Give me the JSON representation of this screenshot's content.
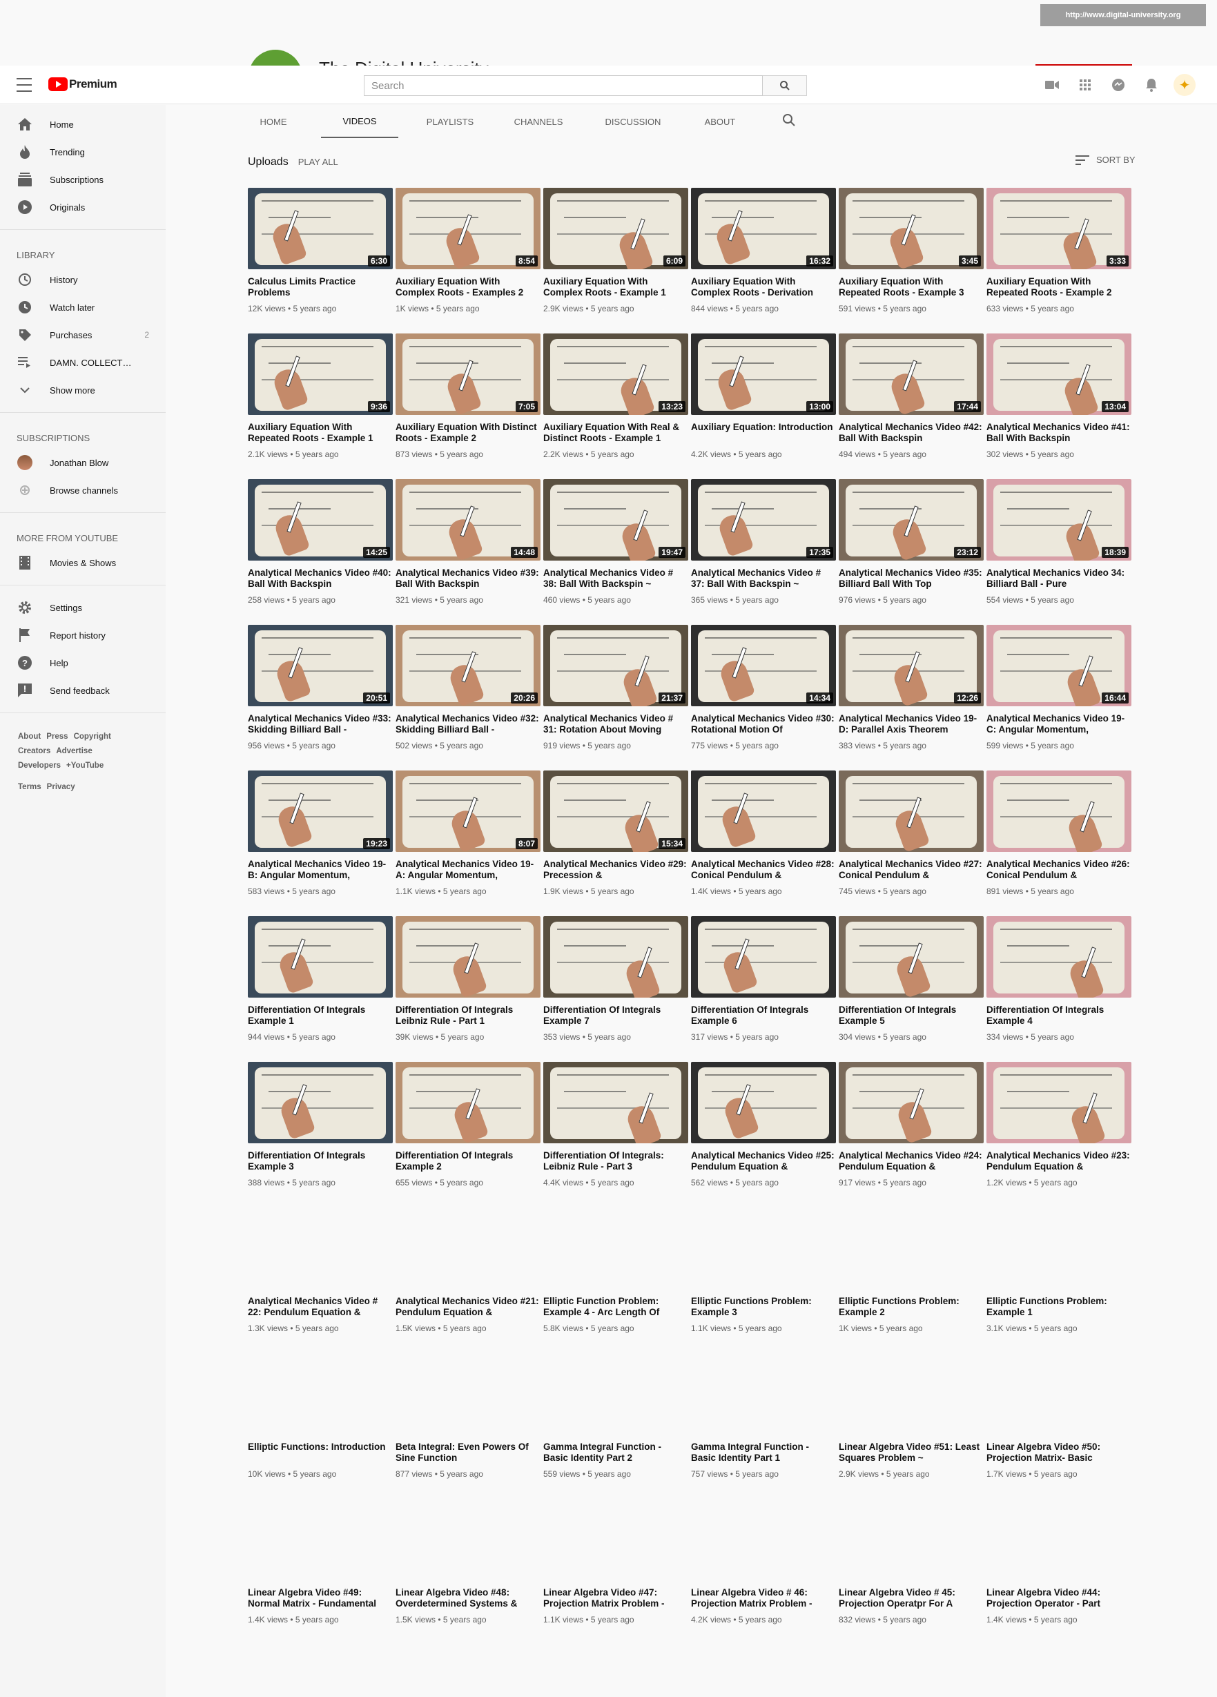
{
  "banner": {
    "url": "http://www.digital-university.org",
    "channel_name_peek": "The Digital University"
  },
  "masthead": {
    "logo_text": "Premium",
    "search_placeholder": "Search"
  },
  "sidebar": {
    "main": [
      {
        "label": "Home",
        "icon": "home-icon"
      },
      {
        "label": "Trending",
        "icon": "fire-icon"
      },
      {
        "label": "Subscriptions",
        "icon": "subscriptions-icon"
      },
      {
        "label": "Originals",
        "icon": "originals-icon"
      }
    ],
    "library_heading": "LIBRARY",
    "library": [
      {
        "label": "History",
        "icon": "history-icon",
        "count": ""
      },
      {
        "label": "Watch later",
        "icon": "clock-icon",
        "count": ""
      },
      {
        "label": "Purchases",
        "icon": "tag-icon",
        "count": "2"
      },
      {
        "label": "DAMN. COLLECT…",
        "icon": "playlist-icon",
        "count": ""
      },
      {
        "label": "Show more",
        "icon": "chevron-down-icon",
        "count": ""
      }
    ],
    "subscriptions_heading": "SUBSCRIPTIONS",
    "subscriptions": [
      {
        "label": "Jonathan Blow"
      },
      {
        "label": "Browse channels"
      }
    ],
    "more_heading": "MORE FROM YOUTUBE",
    "more": [
      {
        "label": "Movies & Shows"
      }
    ],
    "settings": [
      {
        "label": "Settings",
        "icon": "gear-icon"
      },
      {
        "label": "Report history",
        "icon": "flag-icon"
      },
      {
        "label": "Help",
        "icon": "help-icon"
      },
      {
        "label": "Send feedback",
        "icon": "feedback-icon"
      }
    ],
    "footer_line1": [
      "About",
      "Press",
      "Copyright"
    ],
    "footer_line2": [
      "Creators",
      "Advertise"
    ],
    "footer_line3": [
      "Developers",
      "+YouTube"
    ],
    "footer_line4": [
      "Terms",
      "Privacy"
    ]
  },
  "tabs": [
    "HOME",
    "VIDEOS",
    "PLAYLISTS",
    "CHANNELS",
    "DISCUSSION",
    "ABOUT"
  ],
  "active_tab": "VIDEOS",
  "uploads": {
    "title": "Uploads",
    "play_all": "PLAY ALL",
    "sort_by": "SORT BY"
  },
  "videos": [
    {
      "title": "Calculus Limits Practice Problems",
      "meta": "12K views • 5 years ago",
      "duration": "6:30"
    },
    {
      "title": "Auxiliary Equation With Complex Roots - Examples 2",
      "meta": "1K views • 5 years ago",
      "duration": "8:54"
    },
    {
      "title": "Auxiliary Equation With Complex Roots - Example 1",
      "meta": "2.9K views • 5 years ago",
      "duration": "6:09"
    },
    {
      "title": "Auxiliary Equation With Complex Roots - Derivation",
      "meta": "844 views • 5 years ago",
      "duration": "16:32"
    },
    {
      "title": "Auxiliary Equation With Repeated Roots - Example 3",
      "meta": "591 views • 5 years ago",
      "duration": "3:45"
    },
    {
      "title": "Auxiliary Equation With Repeated Roots - Example 2",
      "meta": "633 views • 5 years ago",
      "duration": "3:33"
    },
    {
      "title": "Auxiliary Equation With Repeated Roots - Example 1",
      "meta": "2.1K views • 5 years ago",
      "duration": "9:36"
    },
    {
      "title": "Auxiliary Equation With Distinct Roots - Example 2",
      "meta": "873 views • 5 years ago",
      "duration": "7:05"
    },
    {
      "title": "Auxiliary Equation With Real & Distinct Roots - Example 1",
      "meta": "2.2K views • 5 years ago",
      "duration": "13:23"
    },
    {
      "title": "Auxiliary Equation: Introduction",
      "meta": "4.2K views • 5 years ago",
      "duration": "13:00"
    },
    {
      "title": "Analytical Mechanics Video #42: Ball With Backspin",
      "meta": "494 views • 5 years ago",
      "duration": "17:44"
    },
    {
      "title": "Analytical Mechanics Video #41: Ball With Backspin",
      "meta": "302 views • 5 years ago",
      "duration": "13:04"
    },
    {
      "title": "Analytical Mechanics Video #40: Ball With Backspin",
      "meta": "258 views • 5 years ago",
      "duration": "14:25"
    },
    {
      "title": "Analytical Mechanics Video #39: Ball With Backspin",
      "meta": "321 views • 5 years ago",
      "duration": "14:48"
    },
    {
      "title": "Analytical Mechanics Video # 38: Ball With Backspin ~",
      "meta": "460 views • 5 years ago",
      "duration": "19:47"
    },
    {
      "title": "Analytical Mechanics Video # 37: Ball With Backspin ~",
      "meta": "365 views • 5 years ago",
      "duration": "17:35"
    },
    {
      "title": "Analytical Mechanics Video #35: Billiard Ball With Top",
      "meta": "976 views • 5 years ago",
      "duration": "23:12"
    },
    {
      "title": "Analytical Mechanics Video 34: Billiard Ball - Pure",
      "meta": "554 views • 5 years ago",
      "duration": "18:39"
    },
    {
      "title": "Analytical Mechanics Video #33: Skidding Billiard Ball -",
      "meta": "956 views • 5 years ago",
      "duration": "20:51"
    },
    {
      "title": "Analytical Mechanics Video #32: Skidding Billiard Ball -",
      "meta": "502 views • 5 years ago",
      "duration": "20:26"
    },
    {
      "title": "Analytical Mechanics Video # 31: Rotation About Moving",
      "meta": "919 views • 5 years ago",
      "duration": "21:37"
    },
    {
      "title": "Analytical Mechanics Video #30: Rotational Motion Of",
      "meta": "775 views • 5 years ago",
      "duration": "14:34"
    },
    {
      "title": "Analytical Mechanics Video 19-D: Parallel Axis Theorem",
      "meta": "383 views • 5 years ago",
      "duration": "12:26"
    },
    {
      "title": "Analytical Mechanics Video 19-C: Angular Momentum,",
      "meta": "599 views • 5 years ago",
      "duration": "16:44"
    },
    {
      "title": "Analytical Mechanics Video 19-B: Angular Momentum,",
      "meta": "583 views • 5 years ago",
      "duration": "19:23"
    },
    {
      "title": "Analytical Mechanics Video 19-A: Angular Momentum,",
      "meta": "1.1K views • 5 years ago",
      "duration": "8:07"
    },
    {
      "title": "Analytical Mechanics Video #29: Precession &",
      "meta": "1.9K views • 5 years ago",
      "duration": "15:34"
    },
    {
      "title": "Analytical Mechanics Video #28: Conical Pendulum &",
      "meta": "1.4K views • 5 years ago",
      "duration": ""
    },
    {
      "title": "Analytical Mechanics Video #27: Conical Pendulum &",
      "meta": "745 views • 5 years ago",
      "duration": ""
    },
    {
      "title": "Analytical Mechanics Video #26: Conical Pendulum &",
      "meta": "891 views • 5 years ago",
      "duration": ""
    },
    {
      "title": "Differentiation Of Integrals Example 1",
      "meta": "944 views • 5 years ago",
      "duration": ""
    },
    {
      "title": "Differentiation Of Integrals Leibniz Rule - Part 1",
      "meta": "39K views • 5 years ago",
      "duration": ""
    },
    {
      "title": "Differentiation Of Integrals Example 7",
      "meta": "353 views • 5 years ago",
      "duration": ""
    },
    {
      "title": "Differentiation Of Integrals Example 6",
      "meta": "317 views • 5 years ago",
      "duration": ""
    },
    {
      "title": "Differentiation Of Integrals Example 5",
      "meta": "304 views • 5 years ago",
      "duration": ""
    },
    {
      "title": "Differentiation Of Integrals Example 4",
      "meta": "334 views • 5 years ago",
      "duration": ""
    },
    {
      "title": "Differentiation Of Integrals Example 3",
      "meta": "388 views • 5 years ago",
      "duration": ""
    },
    {
      "title": "Differentiation Of Integrals Example 2",
      "meta": "655 views • 5 years ago",
      "duration": ""
    },
    {
      "title": "Differentiation Of Integrals: Leibniz Rule - Part 3",
      "meta": "4.4K views • 5 years ago",
      "duration": ""
    },
    {
      "title": "Analytical Mechanics Video #25: Pendulum Equation &",
      "meta": "562 views • 5 years ago",
      "duration": ""
    },
    {
      "title": "Analytical Mechanics Video #24: Pendulum Equation &",
      "meta": "917 views • 5 years ago",
      "duration": ""
    },
    {
      "title": "Analytical Mechanics Video #23: Pendulum Equation &",
      "meta": "1.2K views • 5 years ago",
      "duration": ""
    },
    {
      "title": "Analytical Mechanics Video # 22: Pendulum Equation &",
      "meta": "1.3K views • 5 years ago",
      "duration": ""
    },
    {
      "title": "Analytical Mechanics Video #21: Pendulum Equation &",
      "meta": "1.5K views • 5 years ago",
      "duration": ""
    },
    {
      "title": "Elliptic Function Problem: Example 4 - Arc Length Of",
      "meta": "5.8K views • 5 years ago",
      "duration": ""
    },
    {
      "title": "Elliptic Functions Problem: Example 3",
      "meta": "1.1K views • 5 years ago",
      "duration": ""
    },
    {
      "title": "Elliptic Functions Problem: Example 2",
      "meta": "1K views • 5 years ago",
      "duration": ""
    },
    {
      "title": "Elliptic Functions Problem: Example 1",
      "meta": "3.1K views • 5 years ago",
      "duration": ""
    },
    {
      "title": "Elliptic Functions: Introduction",
      "meta": "10K views • 5 years ago",
      "duration": ""
    },
    {
      "title": "Beta Integral: Even Powers Of Sine Function",
      "meta": "877 views • 5 years ago",
      "duration": ""
    },
    {
      "title": "Gamma Integral Function - Basic Identity Part 2",
      "meta": "559 views • 5 years ago",
      "duration": ""
    },
    {
      "title": "Gamma Integral Function - Basic Identity Part 1",
      "meta": "757 views • 5 years ago",
      "duration": ""
    },
    {
      "title": "Linear Algebra Video #51: Least Squares Problem ~",
      "meta": "2.9K views • 5 years ago",
      "duration": ""
    },
    {
      "title": "Linear Algebra Video #50: Projection Matrix- Basic",
      "meta": "1.7K views • 5 years ago",
      "duration": ""
    },
    {
      "title": "Linear Algebra Video #49: Normal Matrix - Fundamental",
      "meta": "1.4K views • 5 years ago",
      "duration": ""
    },
    {
      "title": "Linear Algebra Video #48: Overdetermined Systems &",
      "meta": "1.5K views • 5 years ago",
      "duration": ""
    },
    {
      "title": "Linear Algebra Video #47: Projection Matrix Problem -",
      "meta": "1.1K views • 5 years ago",
      "duration": ""
    },
    {
      "title": "Linear Algebra Video # 46: Projection Matrix Problem -",
      "meta": "4.2K views • 5 years ago",
      "duration": ""
    },
    {
      "title": "Linear Algebra Video # 45: Projection Operatpr For A",
      "meta": "832 views • 5 years ago",
      "duration": ""
    },
    {
      "title": "Linear Algebra Video #44: Projection Operator - Part",
      "meta": "1.4K views • 5 years ago",
      "duration": ""
    }
  ],
  "thumb_loaded_count": 42,
  "colors": {
    "brand_red": "#ff0000",
    "board": "#ece8dc",
    "skin": "#c48a6a",
    "dark_bg": "#2b2b2b"
  }
}
